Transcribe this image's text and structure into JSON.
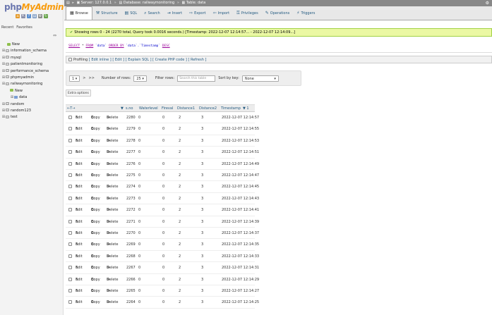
{
  "logo": {
    "php": "php",
    "my": "My",
    "admin": "Admin"
  },
  "left": {
    "recent": "Recent",
    "favorites": "Favorites",
    "collapse": "⇔",
    "tree": [
      {
        "label": "New",
        "type": "new",
        "level": 1
      },
      {
        "label": "information_schema",
        "type": "db",
        "level": 0
      },
      {
        "label": "mysql",
        "type": "db",
        "level": 0
      },
      {
        "label": "patientmonitoring",
        "type": "db",
        "level": 0
      },
      {
        "label": "performance_schema",
        "type": "db",
        "level": 0
      },
      {
        "label": "phpmyadmin",
        "type": "db",
        "level": 0
      },
      {
        "label": "railwaymonitoring",
        "type": "db",
        "level": 0
      },
      {
        "label": "New",
        "type": "new",
        "level": 2
      },
      {
        "label": "data",
        "type": "table",
        "level": 2
      },
      {
        "label": "random",
        "type": "db",
        "level": 0
      },
      {
        "label": "random123",
        "type": "db",
        "level": 0
      },
      {
        "label": "test",
        "type": "db",
        "level": 0
      }
    ]
  },
  "topbar": {
    "server": "Server: 127.0.0.1",
    "database": "Database: railwaymonitoring",
    "table": "Table: data"
  },
  "tabs": [
    {
      "label": "Browse",
      "icon": "▦",
      "active": true
    },
    {
      "label": "Structure",
      "icon": "⚒",
      "active": false
    },
    {
      "label": "SQL",
      "icon": "▤",
      "active": false
    },
    {
      "label": "Search",
      "icon": "⌕",
      "active": false
    },
    {
      "label": "Insert",
      "icon": "⇥",
      "active": false
    },
    {
      "label": "Export",
      "icon": "⇨",
      "active": false
    },
    {
      "label": "Import",
      "icon": "⇦",
      "active": false
    },
    {
      "label": "Privileges",
      "icon": "⚿",
      "active": false
    },
    {
      "label": "Operations",
      "icon": "✎",
      "active": false
    },
    {
      "label": "Triggers",
      "icon": "⚡",
      "active": false
    }
  ],
  "message": "Showing rows 0 - 24 (2270 total, Query took 0.0016 seconds.) [Timestamp: 2022-12-07 12:14:57... - 2022-12-07 12:14:09...]",
  "sql": {
    "select": "SELECT",
    "star": " * ",
    "from": "FROM",
    "table": " `data` ",
    "order": "ORDER BY",
    "col": " `data`.`Timestamp` ",
    "desc": "DESC"
  },
  "profiling": {
    "label": "Profiling",
    "links": "[ Edit inline ] [ Edit ] [ Explain SQL ] [ Create PHP code ] [ Refresh ]"
  },
  "nav": {
    "page": "1",
    "next": ">",
    "last": ">>",
    "rows_label": "Number of rows:",
    "rows_value": "25",
    "filter_label": "Filter rows:",
    "filter_placeholder": "Search this table",
    "sort_label": "Sort by key:",
    "sort_value": "None"
  },
  "extra_options": "Extra options",
  "columns": {
    "arrows": "←T→",
    "sort_marker": "▼",
    "id": "s.no",
    "waterlevel": "Waterlevel",
    "fireval": "Fireval",
    "distance1": "Distance1",
    "distance2": "Distance2",
    "timestamp": "Timestamp",
    "ts_sort": "▼ 1"
  },
  "actions": {
    "edit": "Edit",
    "copy": "Copy",
    "delete": "Delete"
  },
  "rows": [
    {
      "id": "2280",
      "water": "0",
      "fire": "0",
      "d1": "2",
      "d2": "3",
      "ts": "2022-12-07 12:14:57"
    },
    {
      "id": "2279",
      "water": "0",
      "fire": "0",
      "d1": "2",
      "d2": "3",
      "ts": "2022-12-07 12:14:55"
    },
    {
      "id": "2278",
      "water": "0",
      "fire": "0",
      "d1": "2",
      "d2": "3",
      "ts": "2022-12-07 12:14:53"
    },
    {
      "id": "2277",
      "water": "0",
      "fire": "0",
      "d1": "2",
      "d2": "3",
      "ts": "2022-12-07 12:14:51"
    },
    {
      "id": "2276",
      "water": "0",
      "fire": "0",
      "d1": "2",
      "d2": "3",
      "ts": "2022-12-07 12:14:49"
    },
    {
      "id": "2275",
      "water": "0",
      "fire": "0",
      "d1": "2",
      "d2": "3",
      "ts": "2022-12-07 12:14:47"
    },
    {
      "id": "2274",
      "water": "0",
      "fire": "0",
      "d1": "2",
      "d2": "3",
      "ts": "2022-12-07 12:14:45"
    },
    {
      "id": "2273",
      "water": "0",
      "fire": "0",
      "d1": "2",
      "d2": "3",
      "ts": "2022-12-07 12:14:43"
    },
    {
      "id": "2272",
      "water": "0",
      "fire": "0",
      "d1": "2",
      "d2": "3",
      "ts": "2022-12-07 12:14:41"
    },
    {
      "id": "2271",
      "water": "0",
      "fire": "0",
      "d1": "2",
      "d2": "3",
      "ts": "2022-12-07 12:14:39"
    },
    {
      "id": "2270",
      "water": "0",
      "fire": "0",
      "d1": "2",
      "d2": "3",
      "ts": "2022-12-07 12:14:37"
    },
    {
      "id": "2269",
      "water": "0",
      "fire": "0",
      "d1": "2",
      "d2": "3",
      "ts": "2022-12-07 12:14:35"
    },
    {
      "id": "2268",
      "water": "0",
      "fire": "0",
      "d1": "2",
      "d2": "3",
      "ts": "2022-12-07 12:14:33"
    },
    {
      "id": "2267",
      "water": "0",
      "fire": "0",
      "d1": "2",
      "d2": "3",
      "ts": "2022-12-07 12:14:31"
    },
    {
      "id": "2266",
      "water": "0",
      "fire": "0",
      "d1": "2",
      "d2": "3",
      "ts": "2022-12-07 12:14:29"
    },
    {
      "id": "2265",
      "water": "0",
      "fire": "0",
      "d1": "2",
      "d2": "3",
      "ts": "2022-12-07 12:14:27"
    },
    {
      "id": "2264",
      "water": "0",
      "fire": "0",
      "d1": "2",
      "d2": "3",
      "ts": "2022-12-07 12:14:25"
    }
  ]
}
